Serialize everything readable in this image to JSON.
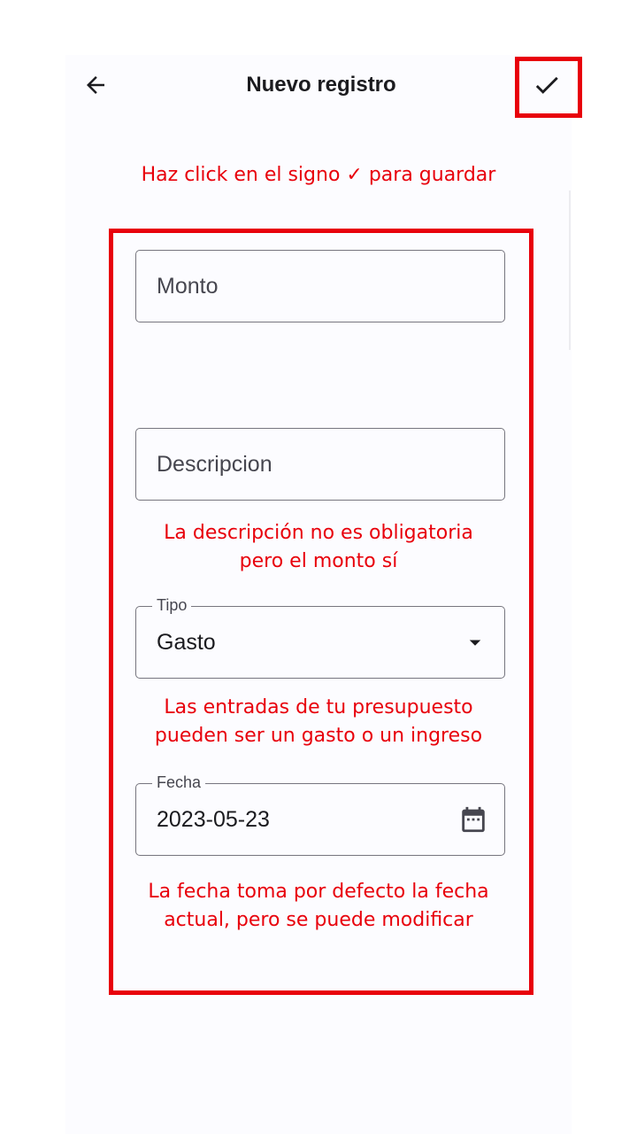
{
  "header": {
    "title": "Nuevo registro"
  },
  "annotations": {
    "save_hint": "Haz click en el signo ✓ para guardar",
    "description_hint": "La descripción no es obligatoria\npero el monto sí",
    "type_hint": "Las entradas de tu presupuesto\npueden ser un gasto o un ingreso",
    "date_hint": "La fecha toma por defecto la fecha\nactual, pero se puede modificar"
  },
  "form": {
    "amount": {
      "placeholder": "Monto"
    },
    "description": {
      "placeholder": "Descripcion"
    },
    "type": {
      "label": "Tipo",
      "value": "Gasto"
    },
    "date": {
      "label": "Fecha",
      "value": "2023-05-23"
    }
  },
  "colors": {
    "annotation": "#e8000b",
    "text": "#1b1b1f",
    "outline": "#77767f",
    "background": "#fcfcff"
  },
  "icons": {
    "back": "arrow-left-icon",
    "save": "check-icon",
    "dropdown": "arrow-drop-down-icon",
    "calendar": "calendar-icon"
  }
}
